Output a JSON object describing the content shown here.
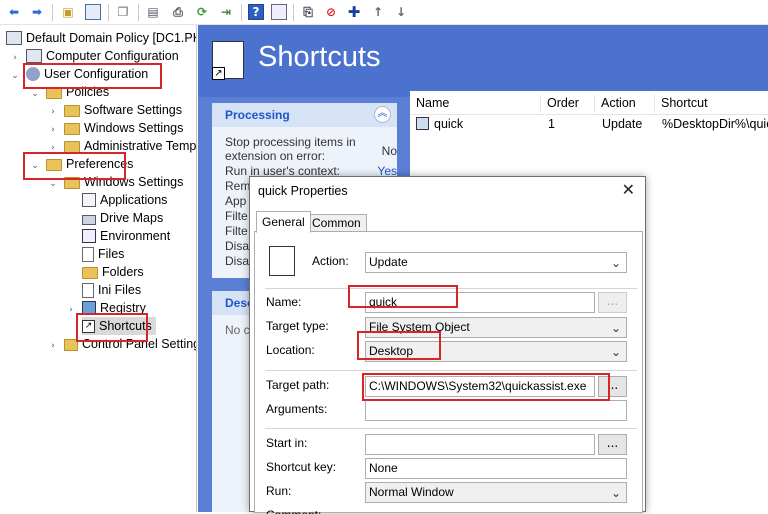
{
  "tree": {
    "root": "Default Domain Policy [DC1.PKI",
    "computer_config": "Computer Configuration",
    "user_config": "User Configuration",
    "policies": "Policies",
    "software_settings": "Software Settings",
    "windows_settings": "Windows Settings",
    "admin_templates": "Administrative Temp",
    "preferences": "Preferences",
    "pref_windows_settings": "Windows Settings",
    "applications": "Applications",
    "drive_maps": "Drive Maps",
    "environment": "Environment",
    "files": "Files",
    "folders": "Folders",
    "ini_files": "Ini Files",
    "registry": "Registry",
    "shortcuts": "Shortcuts",
    "control_panel": "Control Panel Setting"
  },
  "header": {
    "title": "Shortcuts"
  },
  "processing": {
    "title": "Processing",
    "rows": [
      {
        "label": "Stop processing items in",
        "value": ""
      },
      {
        "label": "extension on error:",
        "value": "No"
      },
      {
        "label": "Run in user's context:",
        "value": "Yes"
      },
      {
        "label": "Rem",
        "value": ""
      },
      {
        "label": "App",
        "value": ""
      },
      {
        "label": "Filte",
        "value": ""
      },
      {
        "label": "Filte",
        "value": ""
      },
      {
        "label": "Disa",
        "value": ""
      },
      {
        "label": "Disa",
        "value": ""
      }
    ]
  },
  "description": {
    "title": "Desc",
    "text": "No c"
  },
  "table": {
    "columns": [
      "Name",
      "Order",
      "Action",
      "Shortcut"
    ],
    "rows": [
      {
        "name": "quick",
        "order": "1",
        "action": "Update",
        "shortcut": "%DesktopDir%\\quic"
      }
    ]
  },
  "dialog": {
    "title": "quick Properties",
    "tabs": [
      "General",
      "Common"
    ],
    "action_label": "Action:",
    "action_value": "Update",
    "name_label": "Name:",
    "name_value": "quick",
    "target_type_label": "Target type:",
    "target_type_value": "File System Object",
    "location_label": "Location:",
    "location_value": "Desktop",
    "target_path_label": "Target path:",
    "target_path_value": "C:\\WINDOWS\\System32\\quickassist.exe",
    "arguments_label": "Arguments:",
    "arguments_value": "",
    "start_in_label": "Start in:",
    "start_in_value": "",
    "shortcut_key_label": "Shortcut key:",
    "shortcut_key_value": "None",
    "run_label": "Run:",
    "run_value": "Normal Window",
    "comment_label": "Comment:",
    "browse": "...",
    "close": "✕"
  },
  "colors": {
    "header_blue": "#4b72cf",
    "pane_blue": "#5c7fd6",
    "highlight": "#d6262c",
    "link": "#1f56c9"
  }
}
